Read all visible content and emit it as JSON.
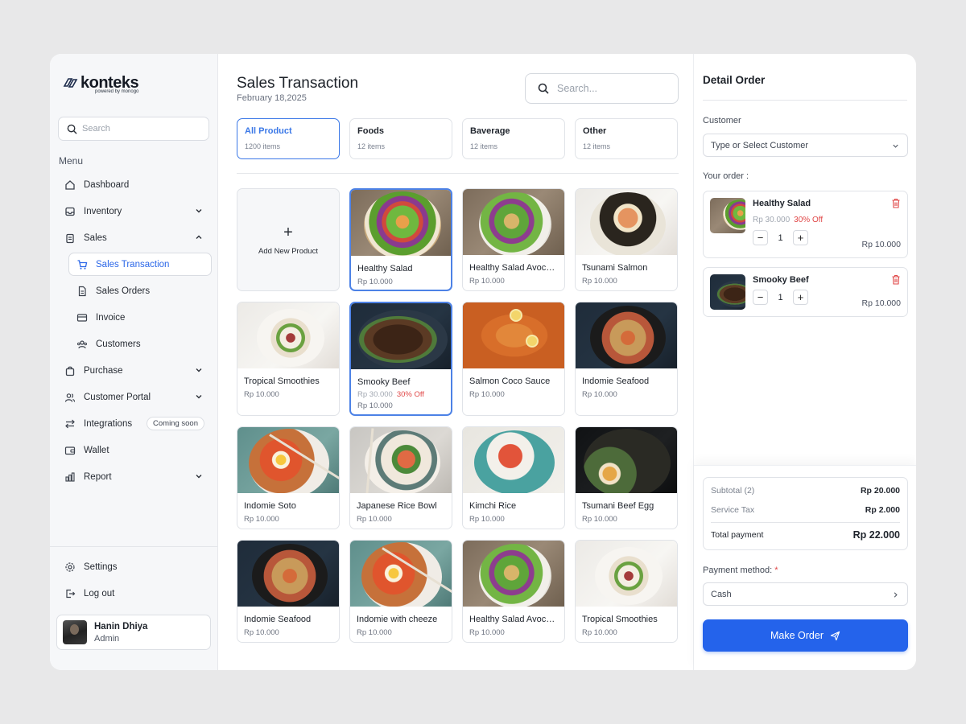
{
  "brand": {
    "name": "konteks",
    "subline": "powered by monogo"
  },
  "sidebar": {
    "search_placeholder": "Search",
    "menu_title": "Menu",
    "items": [
      {
        "label": "Dashboard",
        "icon": "home-icon"
      },
      {
        "label": "Inventory",
        "icon": "inbox-icon"
      },
      {
        "label": "Sales",
        "icon": "clipboard-icon"
      },
      {
        "label": "Sales Transaction",
        "icon": "cart-icon"
      },
      {
        "label": "Sales Orders",
        "icon": "document-icon"
      },
      {
        "label": "Invoice",
        "icon": "card-icon"
      },
      {
        "label": "Customers",
        "icon": "users-icon"
      },
      {
        "label": "Purchase",
        "icon": "bag-icon"
      },
      {
        "label": "Customer Portal",
        "icon": "user-group-icon"
      },
      {
        "label": "Integrations",
        "icon": "swap-icon",
        "badge": "Coming soon"
      },
      {
        "label": "Wallet",
        "icon": "wallet-icon"
      },
      {
        "label": "Report",
        "icon": "chart-icon"
      }
    ],
    "bottom": [
      {
        "label": "Settings",
        "icon": "gear-icon"
      },
      {
        "label": "Log out",
        "icon": "logout-icon"
      }
    ],
    "user": {
      "name": "Hanin Dhiya",
      "role": "Admin"
    }
  },
  "main": {
    "title": "Sales Transaction",
    "date": "February 18,2025",
    "search_placeholder": "Search...",
    "categories": [
      {
        "name": "All Product",
        "count": "1200 items"
      },
      {
        "name": "Foods",
        "count": "12 items"
      },
      {
        "name": "Baverage",
        "count": "12 items"
      },
      {
        "name": "Other",
        "count": "12 items"
      }
    ],
    "add_label": "Add New Product",
    "products": [
      {
        "name": "Healthy Salad",
        "price": "Rp 10.000"
      },
      {
        "name": "Healthy Salad Avocado",
        "price": "Rp 10.000"
      },
      {
        "name": "Tsunami Salmon",
        "price": "Rp 10.000"
      },
      {
        "name": "Tropical Smoothies",
        "price": "Rp 10.000"
      },
      {
        "name": "Smooky Beef",
        "old_price": "Rp 30.000",
        "discount": "30% Off",
        "price": "Rp 10.000"
      },
      {
        "name": "Salmon Coco Sauce",
        "price": "Rp 10.000"
      },
      {
        "name": "Indomie Seafood",
        "price": "Rp 10.000"
      },
      {
        "name": "Indomie Soto",
        "price": "Rp 10.000"
      },
      {
        "name": "Japanese Rice Bowl",
        "price": "Rp 10.000"
      },
      {
        "name": "Kimchi Rice",
        "price": "Rp 10.000"
      },
      {
        "name": "Tsumani Beef Egg",
        "price": "Rp 10.000"
      },
      {
        "name": "Indomie Seafood",
        "price": "Rp 10.000"
      },
      {
        "name": "Indomie with cheeze",
        "price": "Rp 10.000"
      },
      {
        "name": "Healthy Salad Avocado",
        "price": "Rp 10.000"
      },
      {
        "name": "Tropical Smoothies",
        "price": "Rp 10.000"
      }
    ]
  },
  "order": {
    "title": "Detail Order",
    "customer_label": "Customer",
    "customer_placeholder": "Type or Select Customer",
    "your_order_label": "Your order :",
    "items": [
      {
        "name": "Healthy Salad",
        "old_price": "Rp 30.000",
        "discount": "30% Off",
        "qty": "1",
        "total": "Rp 10.000"
      },
      {
        "name": "Smooky Beef",
        "qty": "1",
        "total": "Rp 10.000"
      }
    ],
    "summary": {
      "subtotal_label": "Subtotal (2)",
      "subtotal": "Rp 20.000",
      "tax_label": "Service Tax",
      "tax": "Rp 2.000",
      "total_label": "Total payment",
      "total": "Rp 22.000"
    },
    "payment_label": "Payment method:",
    "required_mark": "*",
    "payment_value": "Cash",
    "submit_label": "Make Order"
  },
  "colors": {
    "accent": "#2463eb",
    "discount": "#e04747",
    "selected_border": "#4d82e6"
  }
}
